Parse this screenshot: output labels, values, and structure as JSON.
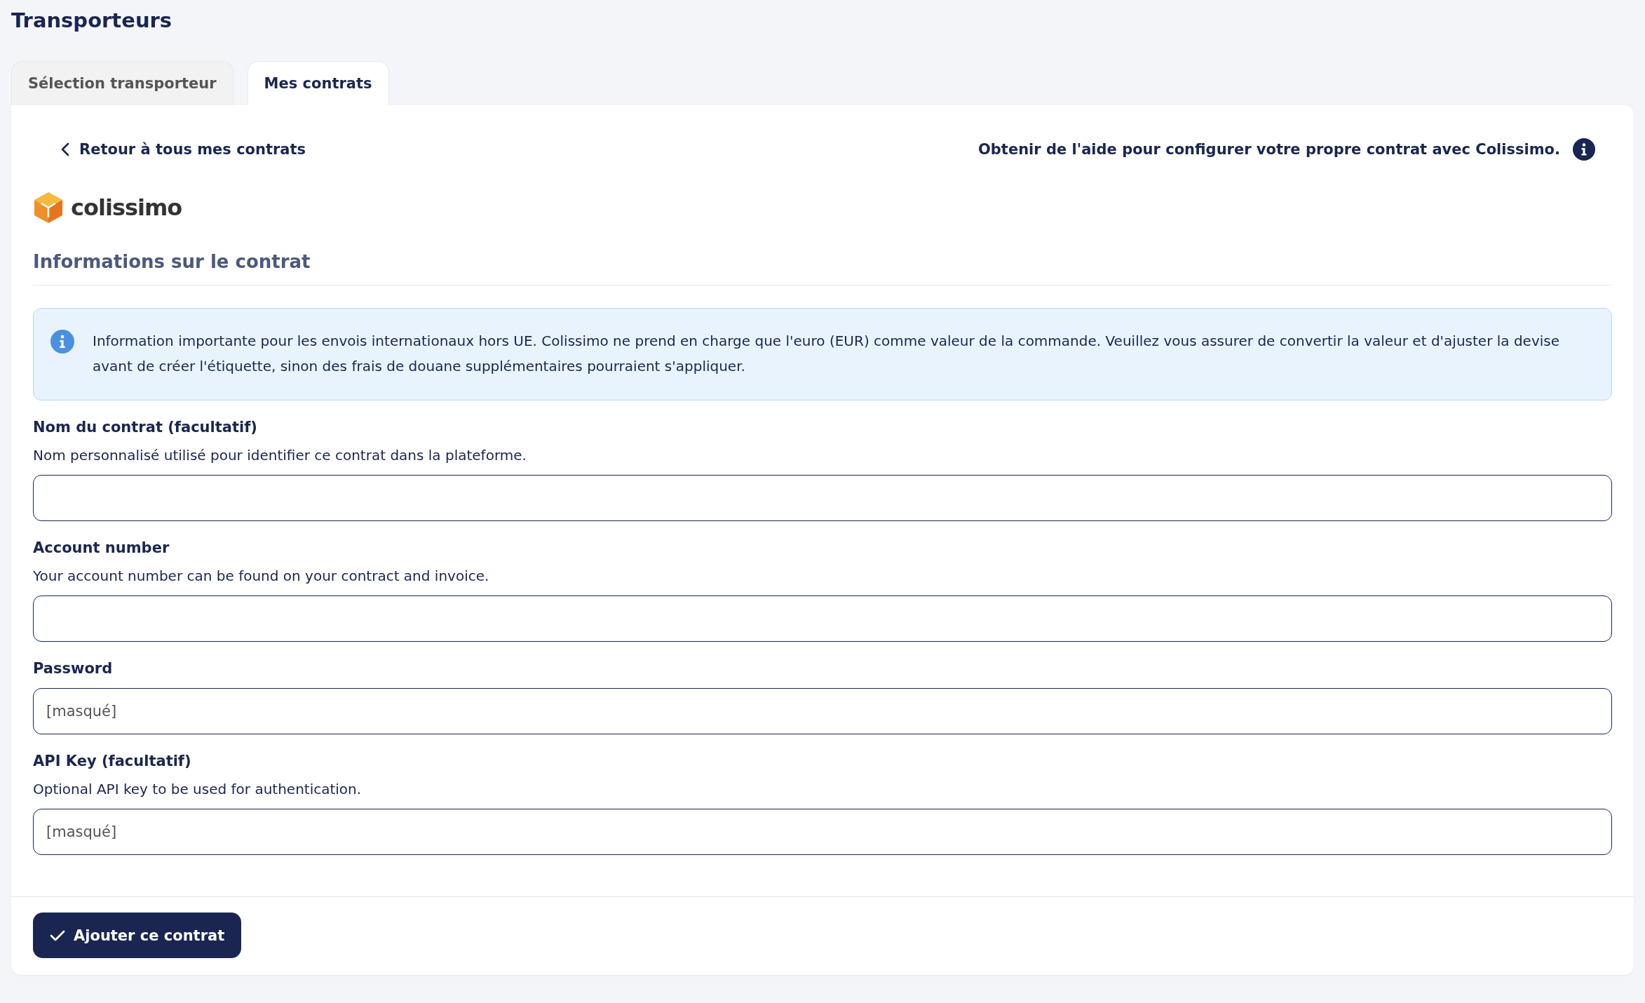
{
  "page_title": "Transporteurs",
  "tabs": [
    {
      "label": "Sélection transporteur",
      "selected": false
    },
    {
      "label": "Mes contrats",
      "selected": true
    }
  ],
  "back_link": "Retour à tous mes contrats",
  "help_link": "Obtenir de l'aide pour configurer votre propre contrat avec Colissimo.",
  "carrier_logo": "colissimo",
  "section_title": "Informations sur le contrat",
  "notice": "Information importante pour les envois internationaux hors UE. Colissimo ne prend en charge que l'euro (EUR) comme valeur de la commande. Veuillez vous assurer de convertir la valeur et d'ajuster la devise avant de créer l'étiquette, sinon des frais de douane supplémentaires pourraient s'appliquer.",
  "fields": [
    {
      "label": "Nom du contrat (facultatif)",
      "help": "Nom personnalisé utilisé pour identifier ce contrat dans la plateforme."
    },
    {
      "label": "Account number",
      "help": "Your account number can be found on your contract and invoice."
    },
    {
      "label": "Password",
      "value": "[masqué]"
    },
    {
      "label": "API Key (facultatif)",
      "help": "Optional API key to be used for authentication.",
      "value": "[masqué]"
    }
  ],
  "submit_button": "Ajouter ce contrat"
}
